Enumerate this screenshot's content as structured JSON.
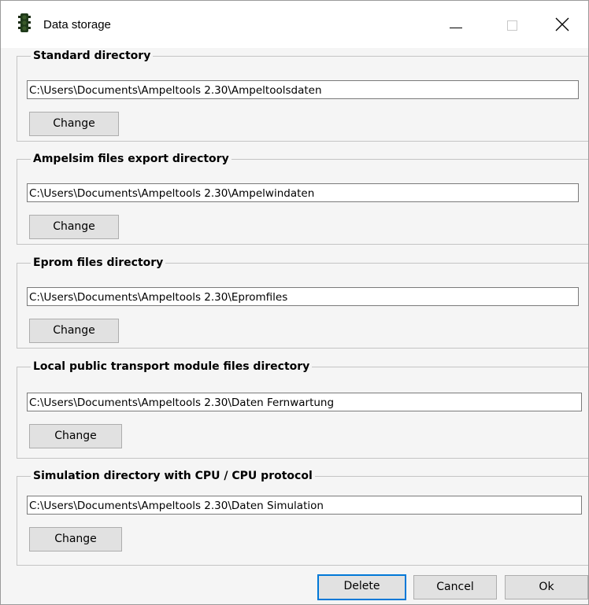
{
  "window": {
    "title": "Data storage",
    "icon": "traffic-light-icon"
  },
  "sections": [
    {
      "label": "Standard directory",
      "path": "C:\\Users\\Documents\\Ampeltools 2.30\\Ampeltoolsdaten",
      "button": "Change"
    },
    {
      "label": "Ampelsim files export directory",
      "path": "C:\\Users\\Documents\\Ampeltools 2.30\\Ampelwindaten",
      "button": "Change"
    },
    {
      "label": "Eprom files directory",
      "path": "C:\\Users\\Documents\\Ampeltools 2.30\\Epromfiles",
      "button": "Change"
    },
    {
      "label": "Local public transport module files directory",
      "path": "C:\\Users\\Documents\\Ampeltools 2.30\\Daten Fernwartung",
      "button": "Change"
    },
    {
      "label": "Simulation directory with CPU / CPU protocol",
      "path": "C:\\Users\\Documents\\Ampeltools 2.30\\Daten Simulation",
      "button": "Change"
    }
  ],
  "footer": {
    "delete": "Delete",
    "cancel": "Cancel",
    "ok": "Ok"
  },
  "colors": {
    "accent": "#0078d7",
    "button_face": "#e1e1e1",
    "dialog_bg": "#f5f5f5"
  }
}
